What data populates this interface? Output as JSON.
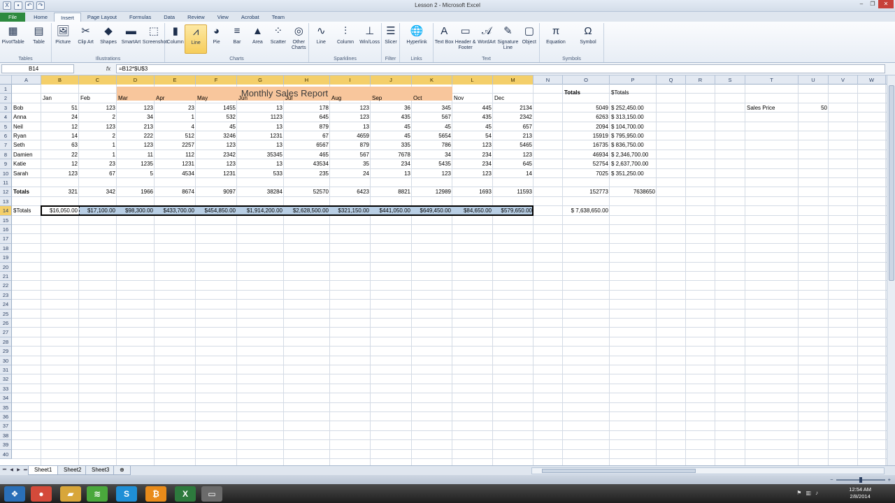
{
  "window": {
    "title": "Lesson 2 - Microsoft Excel",
    "minimize": "–",
    "restore": "❐",
    "close": "✕"
  },
  "ribbon_tabs": [
    "File",
    "Home",
    "Insert",
    "Page Layout",
    "Formulas",
    "Data",
    "Review",
    "View",
    "Acrobat",
    "Team"
  ],
  "active_tab": "Insert",
  "ribbon_groups": [
    {
      "label": "Tables",
      "buttons": [
        {
          "name": "pivot-table",
          "label": "PivotTable",
          "icon": "▦"
        },
        {
          "name": "table",
          "label": "Table",
          "icon": "▤"
        }
      ]
    },
    {
      "label": "Illustrations",
      "buttons": [
        {
          "name": "picture",
          "label": "Picture",
          "icon": "🖼"
        },
        {
          "name": "clip-art",
          "label": "Clip Art",
          "icon": "✂"
        },
        {
          "name": "shapes",
          "label": "Shapes",
          "icon": "◆"
        },
        {
          "name": "smartart",
          "label": "SmartArt",
          "icon": "▬"
        },
        {
          "name": "screenshot",
          "label": "Screenshot",
          "icon": "⬚"
        }
      ]
    },
    {
      "label": "Charts",
      "buttons": [
        {
          "name": "column",
          "label": "Column",
          "icon": "▮"
        },
        {
          "name": "line",
          "label": "Line",
          "icon": "⩘"
        },
        {
          "name": "pie",
          "label": "Pie",
          "icon": "◕"
        },
        {
          "name": "bar",
          "label": "Bar",
          "icon": "≡"
        },
        {
          "name": "area",
          "label": "Area",
          "icon": "▲"
        },
        {
          "name": "scatter",
          "label": "Scatter",
          "icon": "⁘"
        },
        {
          "name": "other-charts",
          "label": "Other Charts",
          "icon": "◎"
        }
      ]
    },
    {
      "label": "Sparklines",
      "buttons": [
        {
          "name": "spark-line",
          "label": "Line",
          "icon": "∿"
        },
        {
          "name": "spark-column",
          "label": "Column",
          "icon": "⫶"
        },
        {
          "name": "win-loss",
          "label": "Win/Loss",
          "icon": "⊥"
        }
      ]
    },
    {
      "label": "Filter",
      "buttons": [
        {
          "name": "slicer",
          "label": "Slicer",
          "icon": "☰"
        }
      ]
    },
    {
      "label": "Links",
      "buttons": [
        {
          "name": "hyperlink",
          "label": "Hyperlink",
          "icon": "🌐"
        }
      ]
    },
    {
      "label": "Text",
      "buttons": [
        {
          "name": "text-box",
          "label": "Text Box",
          "icon": "A"
        },
        {
          "name": "header-footer",
          "label": "Header & Footer",
          "icon": "▭"
        },
        {
          "name": "wordart",
          "label": "WordArt",
          "icon": "𝒜"
        },
        {
          "name": "signature-line",
          "label": "Signature Line",
          "icon": "✎"
        },
        {
          "name": "object",
          "label": "Object",
          "icon": "▢"
        }
      ]
    },
    {
      "label": "Symbols",
      "buttons": [
        {
          "name": "equation",
          "label": "Equation",
          "icon": "π"
        },
        {
          "name": "symbol",
          "label": "Symbol",
          "icon": "Ω"
        }
      ]
    }
  ],
  "active_button": "line",
  "formula_bar": {
    "name_box": "B14",
    "fx": "fx",
    "formula": "=B12*$U$3"
  },
  "columns": [
    "A",
    "B",
    "C",
    "D",
    "E",
    "F",
    "G",
    "H",
    "I",
    "J",
    "K",
    "L",
    "M",
    "N",
    "O",
    "P",
    "Q",
    "R",
    "S",
    "T",
    "U",
    "V",
    "W"
  ],
  "selected_columns": [
    "B",
    "C",
    "D",
    "E",
    "F",
    "G",
    "H",
    "I",
    "J",
    "K",
    "L",
    "M"
  ],
  "row_count": 40,
  "selected_row": 14,
  "sheet": {
    "banner_title": "Monthly Sales Report",
    "months": [
      "Jan",
      "Feb",
      "Mar",
      "Apr",
      "May",
      "Jun",
      "Jul",
      "Aug",
      "Sep",
      "Oct",
      "Nov",
      "Dec"
    ],
    "totals_header": "Totals",
    "dollar_totals_header": "$Totals",
    "sales_price_label": "Sales Price",
    "sales_price_value": "50",
    "people": [
      {
        "name": "Bob",
        "values": [
          "51",
          "123",
          "123",
          "23",
          "1455",
          "13",
          "178",
          "123",
          "36",
          "345",
          "445",
          "2134"
        ],
        "total": "5049",
        "dollar": "$    252,450.00"
      },
      {
        "name": "Anna",
        "values": [
          "24",
          "2",
          "34",
          "1",
          "532",
          "1123",
          "645",
          "123",
          "435",
          "567",
          "435",
          "2342"
        ],
        "total": "6263",
        "dollar": "$    313,150.00"
      },
      {
        "name": "Neil",
        "values": [
          "12",
          "123",
          "213",
          "4",
          "45",
          "13",
          "879",
          "13",
          "45",
          "45",
          "45",
          "657"
        ],
        "total": "2094",
        "dollar": "$    104,700.00"
      },
      {
        "name": "Ryan",
        "values": [
          "14",
          "2",
          "222",
          "512",
          "3246",
          "1231",
          "67",
          "4659",
          "45",
          "5654",
          "54",
          "213"
        ],
        "total": "15919",
        "dollar": "$    795,950.00"
      },
      {
        "name": "Seth",
        "values": [
          "63",
          "1",
          "123",
          "2257",
          "123",
          "13",
          "6567",
          "879",
          "335",
          "786",
          "123",
          "5465"
        ],
        "total": "16735",
        "dollar": "$    836,750.00"
      },
      {
        "name": "Damien",
        "values": [
          "22",
          "1",
          "11",
          "112",
          "2342",
          "35345",
          "465",
          "567",
          "7678",
          "34",
          "234",
          "123"
        ],
        "total": "46934",
        "dollar": "$ 2,346,700.00"
      },
      {
        "name": "Katie",
        "values": [
          "12",
          "23",
          "1235",
          "1231",
          "123",
          "13",
          "43534",
          "35",
          "234",
          "5435",
          "234",
          "645"
        ],
        "total": "52754",
        "dollar": "$ 2,637,700.00"
      },
      {
        "name": "Sarah",
        "values": [
          "123",
          "67",
          "5",
          "4534",
          "1231",
          "533",
          "235",
          "24",
          "13",
          "123",
          "123",
          "14"
        ],
        "total": "7025",
        "dollar": "$    351,250.00"
      }
    ],
    "totals_row_label": "Totals",
    "totals_row": [
      "321",
      "342",
      "1966",
      "8674",
      "9097",
      "38284",
      "52570",
      "6423",
      "8821",
      "12989",
      "1693",
      "11593"
    ],
    "totals_sum": "152773",
    "totals_dollar_sum": "7638650",
    "dollar_row_label": "$Totals",
    "dollar_row": [
      "$16,050.00",
      "$17,100.00",
      "$98,300.00",
      "$433,700.00",
      "$454,850.00",
      "$1,914,200.00",
      "$2,628,500.00",
      "$321,150.00",
      "$441,050.00",
      "$649,450.00",
      "$84,650.00",
      "$579,650.00"
    ],
    "dollar_row_total": "$ 7,638,650.00"
  },
  "sheet_tabs": [
    "Sheet1",
    "Sheet2",
    "Sheet3"
  ],
  "active_sheet": "Sheet1",
  "status": {
    "zoom_minus": "−",
    "zoom_plus": "+"
  },
  "taskbar": {
    "apps": [
      {
        "name": "start",
        "icon": "❖",
        "color": "#2a6fb8"
      },
      {
        "name": "chrome",
        "icon": "●",
        "color": "#d44a3a"
      },
      {
        "name": "explorer",
        "icon": "▰",
        "color": "#d8a63a"
      },
      {
        "name": "spotify",
        "icon": "≋",
        "color": "#4aa83c"
      },
      {
        "name": "skype",
        "icon": "S",
        "color": "#1f8fd6"
      },
      {
        "name": "bitcoin",
        "icon": "₿",
        "color": "#e98b1a"
      },
      {
        "name": "excel",
        "icon": "X",
        "color": "#2d7a3d"
      },
      {
        "name": "window",
        "icon": "▭",
        "color": "#6b6b6b"
      }
    ],
    "time": "12:54 AM",
    "date": "2/8/2014"
  },
  "colors": {
    "accent_selection": "#f4cf6a",
    "banner": "#f8c69c",
    "highlight_row": "#b8cee4"
  }
}
